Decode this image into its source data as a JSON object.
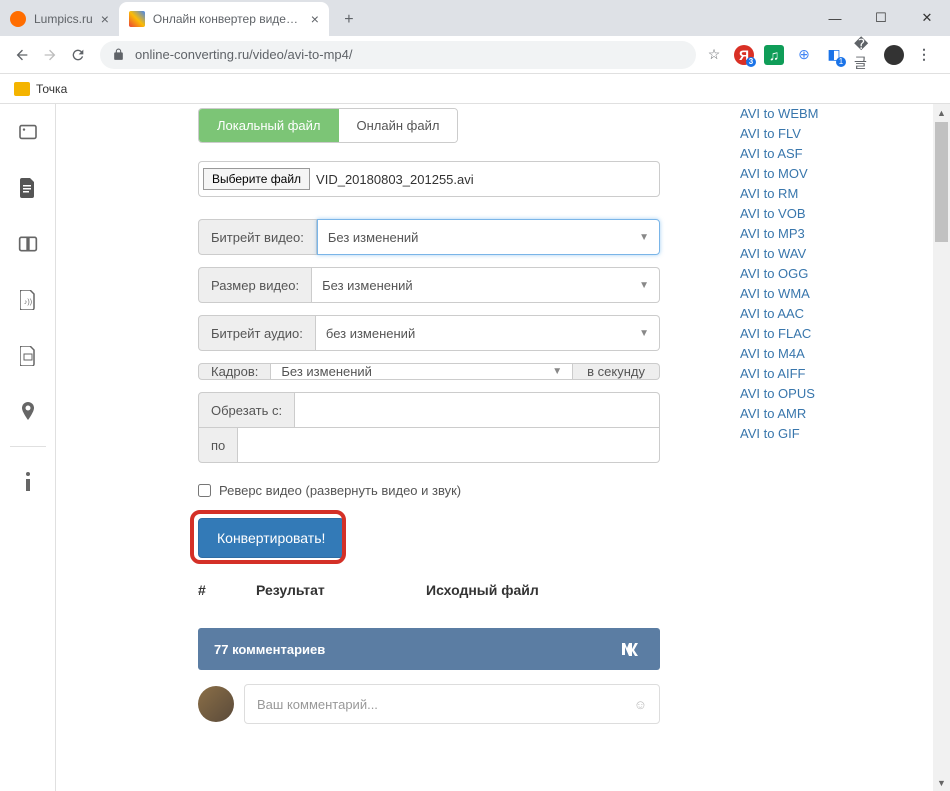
{
  "tabs": [
    {
      "label": "Lumpics.ru"
    },
    {
      "label": "Онлайн конвертер видео из AVI"
    }
  ],
  "url": "online-converting.ru/video/avi-to-mp4/",
  "bookmark": "Точка",
  "form": {
    "tab_local": "Локальный файл",
    "tab_online": "Онлайн файл",
    "choose_btn": "Выберите файл",
    "filename": "VID_20180803_201255.avi",
    "bitrate_video_label": "Битрейт видео:",
    "bitrate_video_value": "Без изменений",
    "size_label": "Размер видео:",
    "size_value": "Без изменений",
    "bitrate_audio_label": "Битрейт аудио:",
    "bitrate_audio_value": "без изменений",
    "frames_label": "Кадров:",
    "frames_value": "Без изменений",
    "frames_unit": "в секунду",
    "trim_from_label": "Обрезать с:",
    "trim_to_label": "по",
    "reverse_label": "Реверс видео (развернуть видео и звук)",
    "convert_btn": "Конвертировать!",
    "result_num": "#",
    "result_col1": "Результат",
    "result_col2": "Исходный файл",
    "comments_count": "77 комментариев",
    "vk": "w",
    "comment_placeholder": "Ваш комментарий..."
  },
  "sidebar_links": [
    "AVI to WEBM",
    "AVI to FLV",
    "AVI to ASF",
    "AVI to MOV",
    "AVI to RM",
    "AVI to VOB",
    "AVI to MP3",
    "AVI to WAV",
    "AVI to OGG",
    "AVI to WMA",
    "AVI to AAC",
    "AVI to FLAC",
    "AVI to M4A",
    "AVI to AIFF",
    "AVI to OPUS",
    "AVI to AMR",
    "AVI to GIF"
  ]
}
